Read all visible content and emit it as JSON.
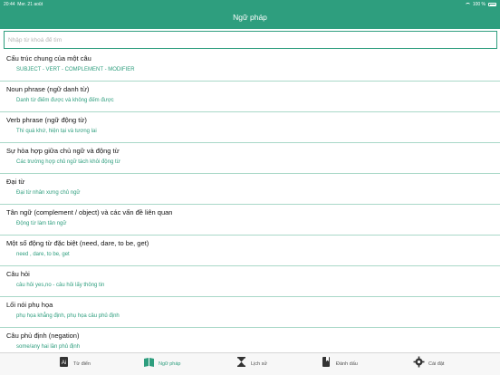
{
  "status": {
    "time": "20:44",
    "date": "Mer. 21 août",
    "battery": "100 %"
  },
  "header": {
    "title": "Ngữ pháp"
  },
  "search": {
    "placeholder": "Nhập từ khoá để tìm",
    "value": ""
  },
  "items": [
    {
      "title": "Cấu trúc chung của một câu",
      "subtitle": "SUBJECT - VERT - COMPLEMENT - MODIFIER"
    },
    {
      "title": "Noun phrase (ngữ danh từ)",
      "subtitle": "Danh từ điếm được và không đếm được"
    },
    {
      "title": "Verb phrase (ngữ động từ)",
      "subtitle": "Thì quá khứ, hiện tại và tương lai"
    },
    {
      "title": "Sự hòa hợp giữa chủ ngữ và động từ",
      "subtitle": "Các trường hợp chủ ngữ tách khỏi động từ"
    },
    {
      "title": "Đại từ",
      "subtitle": "Đại từ nhân xưng chủ ngữ"
    },
    {
      "title": "Tân ngữ (complement / object) và các vấn đề liên quan",
      "subtitle": "Động từ làm tân ngữ"
    },
    {
      "title": "Một số động từ đặc biệt (need, dare, to be, get)",
      "subtitle": "need , dare, to be, get"
    },
    {
      "title": "Câu hỏi",
      "subtitle": "câu hỏi yes,no - câu hỏi lấy thông tin"
    },
    {
      "title": "Lối nói phụ họa",
      "subtitle": "phụ họa khẳng định, phụ họa câu phủ định"
    },
    {
      "title": "Câu phủ định (negation)",
      "subtitle": "some/any hai lần phủ định"
    }
  ],
  "tabs": [
    {
      "label": "Từ điển",
      "icon": "dictionary-icon",
      "active": false
    },
    {
      "label": "Ngữ pháp",
      "icon": "grammar-book-icon",
      "active": true
    },
    {
      "label": "Lịch sử",
      "icon": "hourglass-icon",
      "active": false
    },
    {
      "label": "Đánh dấu",
      "icon": "bookmark-icon",
      "active": false
    },
    {
      "label": "Cài đặt",
      "icon": "gear-icon",
      "active": false
    }
  ],
  "colors": {
    "accent": "#2e9e7e",
    "divider": "#a9d8c8"
  }
}
